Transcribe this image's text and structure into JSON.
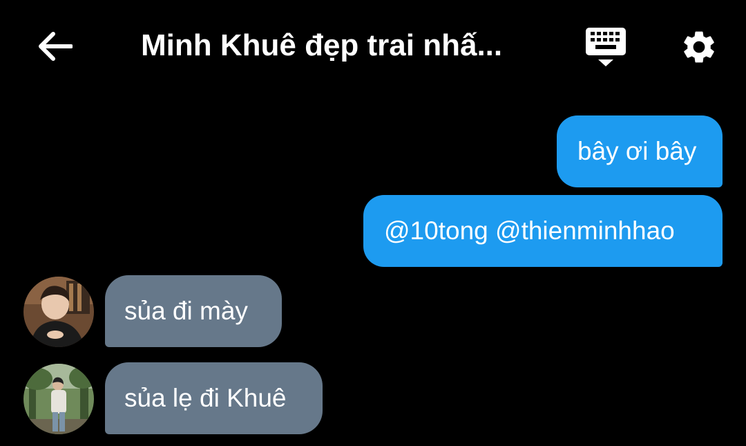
{
  "header": {
    "title": "Minh Khuê đẹp trai nhấ...",
    "back_icon": "arrow-left-icon",
    "keyboard_icon": "keyboard-icon",
    "settings_icon": "gear-icon"
  },
  "messages": [
    {
      "direction": "outgoing",
      "text": "bây ơi bây"
    },
    {
      "direction": "outgoing",
      "text": "@10tong @thienminhhao"
    },
    {
      "direction": "incoming",
      "text": "sủa đi mày",
      "avatar": "avatar-photo"
    },
    {
      "direction": "incoming",
      "text": "sủa lẹ đi Khuê",
      "avatar": "avatar-photo"
    }
  ],
  "colors": {
    "background": "#000000",
    "outgoing_bubble": "#1d9bf0",
    "incoming_bubble": "#66788a",
    "text": "#ffffff"
  }
}
